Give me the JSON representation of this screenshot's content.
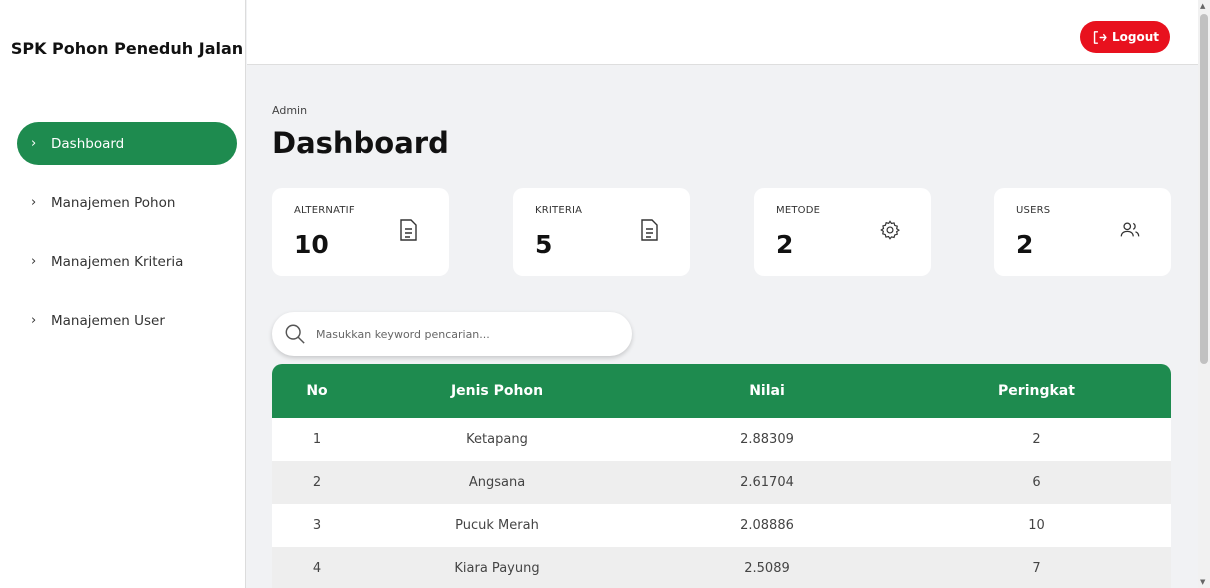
{
  "app": {
    "brand": "SPK Pohon Peneduh Jalan"
  },
  "sidebar": {
    "items": [
      {
        "label": "Dashboard",
        "active": true
      },
      {
        "label": "Manajemen Pohon",
        "active": false
      },
      {
        "label": "Manajemen Kriteria",
        "active": false
      },
      {
        "label": "Manajemen User",
        "active": false
      }
    ]
  },
  "topbar": {
    "logout_label": "Logout"
  },
  "header": {
    "breadcrumb": "Admin",
    "title": "Dashboard"
  },
  "cards": [
    {
      "label": "ALTERNATIF",
      "value": "10",
      "icon": "document-icon"
    },
    {
      "label": "KRITERIA",
      "value": "5",
      "icon": "document-icon"
    },
    {
      "label": "METODE",
      "value": "2",
      "icon": "gear-icon"
    },
    {
      "label": "USERS",
      "value": "2",
      "icon": "users-icon"
    }
  ],
  "search": {
    "placeholder": "Masukkan keyword pencarian..."
  },
  "table": {
    "headers": [
      "No",
      "Jenis Pohon",
      "Nilai",
      "Peringkat"
    ],
    "rows": [
      [
        "1",
        "Ketapang",
        "2.88309",
        "2"
      ],
      [
        "2",
        "Angsana",
        "2.61704",
        "6"
      ],
      [
        "3",
        "Pucuk Merah",
        "2.08886",
        "10"
      ],
      [
        "4",
        "Kiara Payung",
        "2.5089",
        "7"
      ]
    ]
  },
  "colors": {
    "accent": "#1e8b4f",
    "danger": "#e8111e",
    "background": "#f1f2f4"
  }
}
